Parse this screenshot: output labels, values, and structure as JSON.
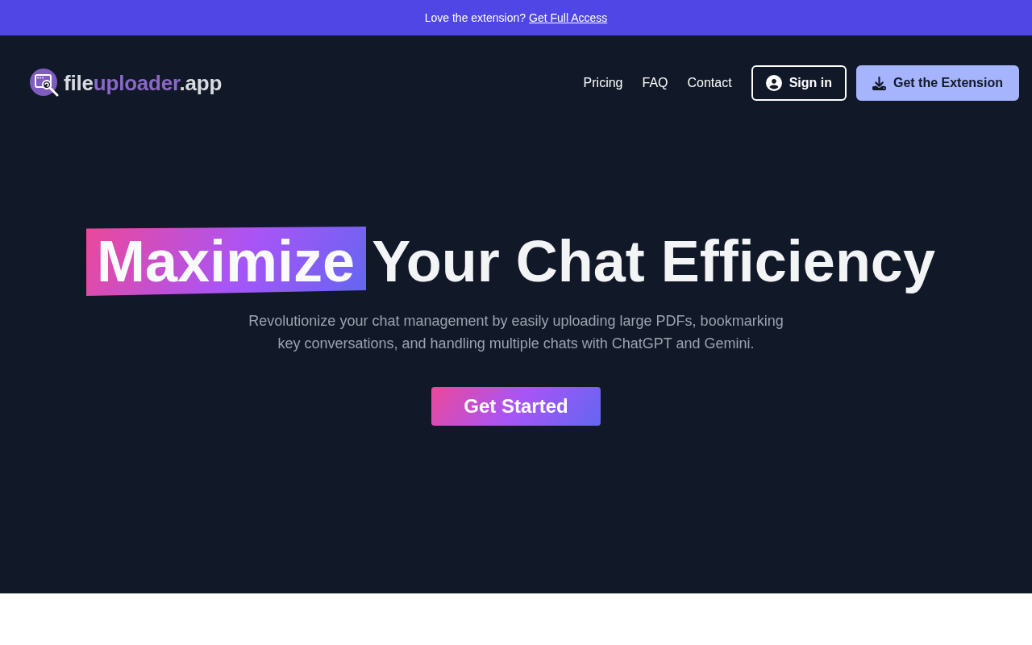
{
  "banner": {
    "text": "Love the extension?",
    "link": "Get Full Access"
  },
  "nav": {
    "logo": {
      "parts": [
        {
          "text": "file",
          "kind": "plain"
        },
        {
          "text": "uploader",
          "kind": "accent"
        },
        {
          "text": ".app",
          "kind": "plain"
        }
      ]
    },
    "links": [
      {
        "label": "Pricing"
      },
      {
        "label": "FAQ"
      },
      {
        "label": "Contact"
      }
    ],
    "buttons": [
      {
        "kind": "outline",
        "label": "Sign in"
      },
      {
        "kind": "solid",
        "label": "Get the Extension"
      }
    ]
  },
  "hero": {
    "title": {
      "highlight": "Maximize",
      "rest": "Your Chat Efficiency"
    },
    "subtitle": "Revolutionize your chat management by easily uploading large PDFs, bookmarking key conversations, and handling multiple chats with ChatGPT and Gemini.",
    "cta": "Get Started"
  }
}
